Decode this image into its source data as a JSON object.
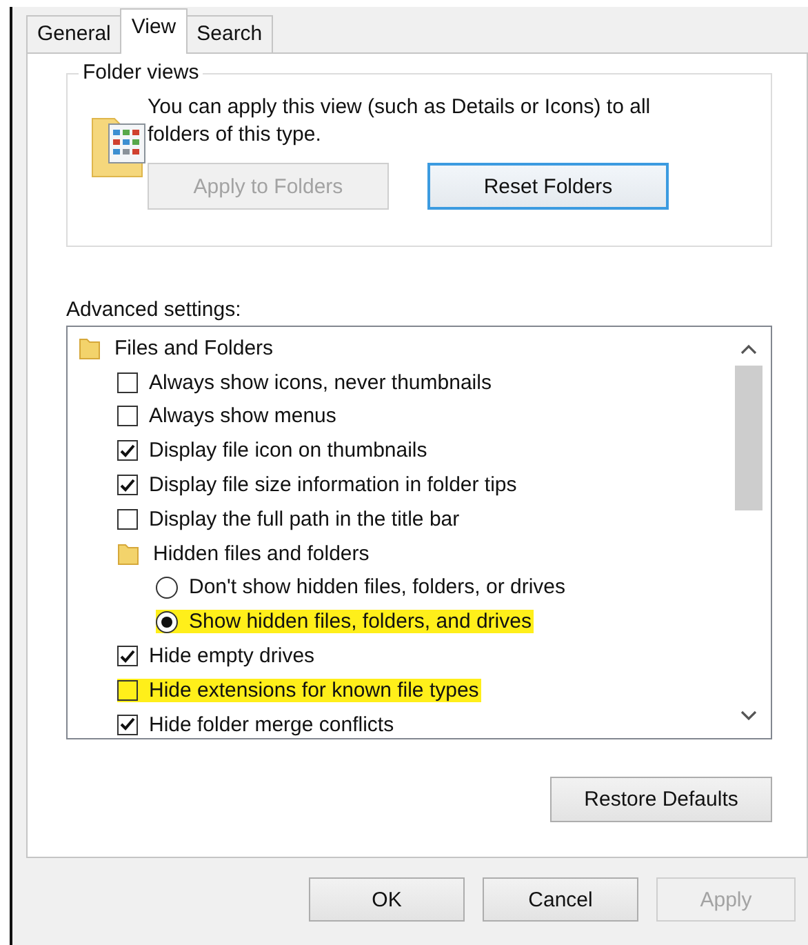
{
  "tabs": [
    {
      "label": "General",
      "selected": false
    },
    {
      "label": "View",
      "selected": true
    },
    {
      "label": "Search",
      "selected": false
    }
  ],
  "folder_views": {
    "title": "Folder views",
    "description": "You can apply this view (such as Details or Icons) to all folders of this type.",
    "buttons": [
      {
        "label": "Apply to Folders",
        "disabled": true,
        "focused": false
      },
      {
        "label": "Reset Folders",
        "disabled": false,
        "focused": true
      }
    ]
  },
  "advanced_settings": {
    "label": "Advanced settings:",
    "items": [
      {
        "kind": "folder",
        "label": "Files and Folders",
        "children": [
          {
            "kind": "checkbox",
            "label": "Always show icons, never thumbnails",
            "checked": false,
            "highlighted": false
          },
          {
            "kind": "checkbox",
            "label": "Always show menus",
            "checked": false,
            "highlighted": false
          },
          {
            "kind": "checkbox",
            "label": "Display file icon on thumbnails",
            "checked": true,
            "highlighted": false
          },
          {
            "kind": "checkbox",
            "label": "Display file size information in folder tips",
            "checked": true,
            "highlighted": false
          },
          {
            "kind": "checkbox",
            "label": "Display the full path in the title bar",
            "checked": false,
            "highlighted": false
          },
          {
            "kind": "folder",
            "label": "Hidden files and folders",
            "children": [
              {
                "kind": "radio",
                "label": "Don't show hidden files, folders, or drives",
                "selected": false,
                "highlighted": false
              },
              {
                "kind": "radio",
                "label": "Show hidden files, folders, and drives",
                "selected": true,
                "highlighted": true
              }
            ]
          },
          {
            "kind": "checkbox",
            "label": "Hide empty drives",
            "checked": true,
            "highlighted": false
          },
          {
            "kind": "checkbox",
            "label": "Hide extensions for known file types",
            "checked": false,
            "highlighted": true
          },
          {
            "kind": "checkbox",
            "label": "Hide folder merge conflicts",
            "checked": true,
            "highlighted": false
          }
        ]
      }
    ],
    "restore_button": "Restore Defaults"
  },
  "buttons": [
    {
      "label": "OK",
      "disabled": false
    },
    {
      "label": "Cancel",
      "disabled": false
    },
    {
      "label": "Apply",
      "disabled": true
    }
  ]
}
